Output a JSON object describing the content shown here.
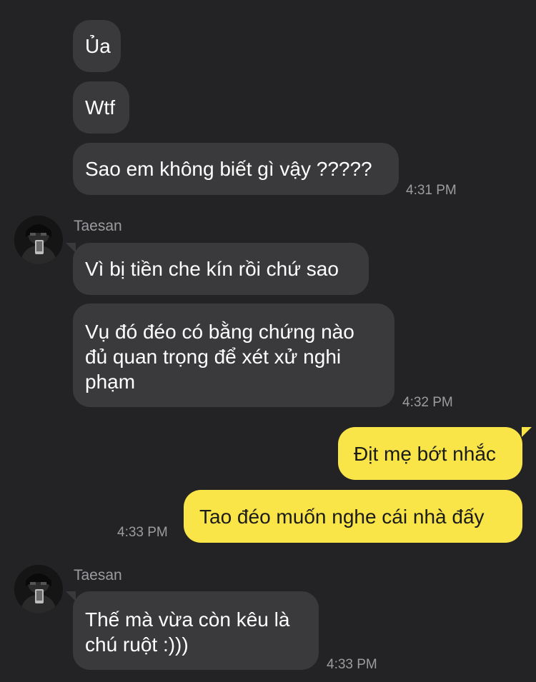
{
  "messages": {
    "m1": "Ủa",
    "m2": "Wtf",
    "m3": "Sao em không biết gì vậy ?????",
    "t1": "4:31 PM",
    "sender1": "Taesan",
    "m4": "Vì bị tiền che kín rồi chứ sao",
    "m5": "Vụ đó đéo có bằng chứng nào\nđủ quan trọng để xét xử nghi\nphạm",
    "t2": "4:32 PM",
    "m6": "Địt mẹ bớt nhắc",
    "m7": "Tao đéo muốn nghe cái nhà đấy",
    "t3": "4:33 PM",
    "sender2": "Taesan",
    "m8": "Thế mà vừa còn kêu là\nchú ruột :)))",
    "t4": "4:33 PM"
  },
  "colors": {
    "background": "#232325",
    "incoming_bubble": "#3a3a3c",
    "outgoing_bubble": "#f9e547",
    "timestamp": "#9c9ca0"
  },
  "icons": {
    "avatar": "profile-photo"
  }
}
